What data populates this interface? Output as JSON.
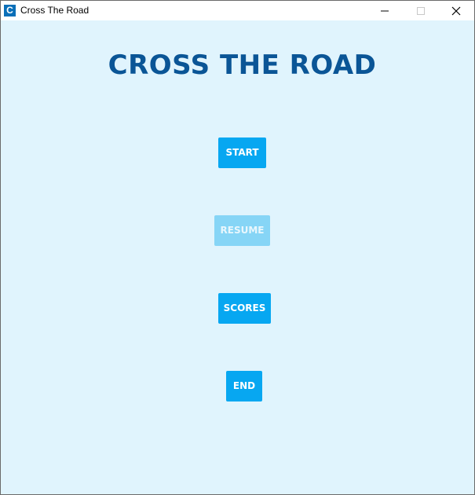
{
  "window": {
    "title": "Cross The Road",
    "icon_letter": "C",
    "icon_name": "app-icon"
  },
  "controls": {
    "minimize_icon": "minimize-icon",
    "maximize_icon": "maximize-icon",
    "close_icon": "close-icon"
  },
  "main": {
    "title": "CROSS THE ROAD"
  },
  "menu": {
    "start": {
      "label": "START",
      "enabled": true
    },
    "resume": {
      "label": "RESUME",
      "enabled": false
    },
    "scores": {
      "label": "SCORES",
      "enabled": true
    },
    "end": {
      "label": "END",
      "enabled": true
    }
  },
  "colors": {
    "background": "#e0f4fd",
    "title": "#0a5596",
    "button": "#07a7f1",
    "button_disabled": "#86d5f6"
  }
}
